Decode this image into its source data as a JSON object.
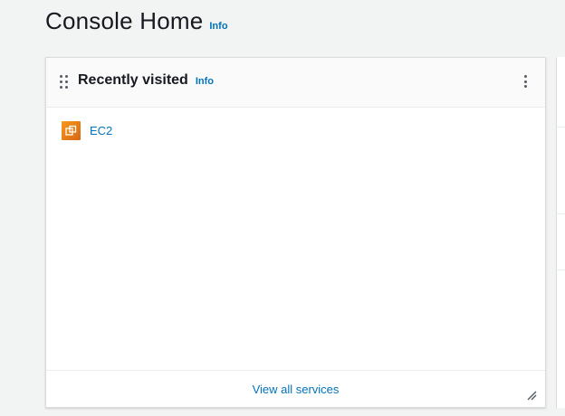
{
  "header": {
    "title": "Console Home",
    "info_label": "Info"
  },
  "widget": {
    "title": "Recently visited",
    "info_label": "Info",
    "services": [
      {
        "label": "EC2",
        "icon": "ec2-service-icon"
      }
    ],
    "footer_link": "View all services"
  },
  "colors": {
    "link": "#0073bb",
    "ec2_orange": "#e07b17",
    "page_background": "#f2f3f3"
  }
}
